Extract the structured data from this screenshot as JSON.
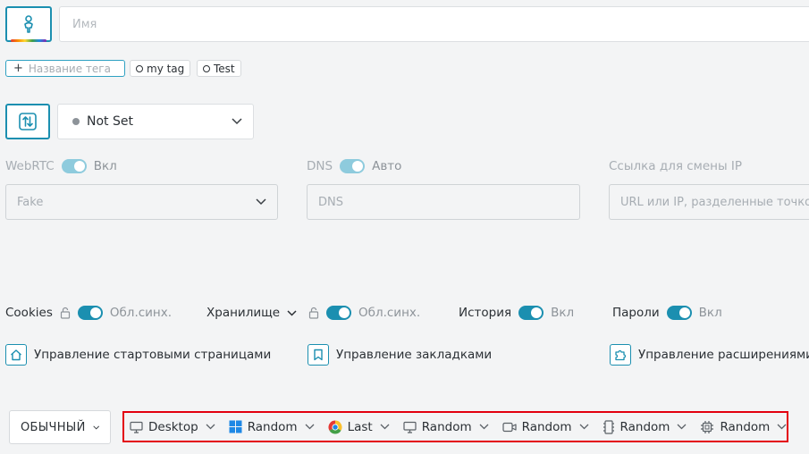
{
  "profile": {
    "name_placeholder": "Имя"
  },
  "tags": {
    "add_placeholder": "Название тега",
    "items": [
      {
        "label": "my tag"
      },
      {
        "label": "Test"
      }
    ]
  },
  "status": {
    "selected": "Not Set"
  },
  "webrtc": {
    "label": "WebRTC",
    "state": "Вкл",
    "value": "Fake"
  },
  "dns": {
    "label": "DNS",
    "state": "Авто",
    "placeholder": "DNS"
  },
  "ip_change": {
    "label": "Ссылка для смены IP",
    "placeholder": "URL или IP, разделенные точкой с запятой"
  },
  "sync": {
    "cookies_label": "Cookies",
    "cookies_state": "Обл.синх.",
    "storage_label": "Хранилище",
    "storage_state": "Обл.синх.",
    "history_label": "История",
    "history_state": "Вкл",
    "passwords_label": "Пароли",
    "passwords_state": "Вкл"
  },
  "links": {
    "start_pages": "Управление стартовыми страницами",
    "bookmarks": "Управление закладками",
    "extensions": "Управление расширениями"
  },
  "mode": {
    "label": "ОБЫЧНЫЙ"
  },
  "fingerprint": {
    "device": "Desktop",
    "os": "Random",
    "browser": "Last",
    "screen": "Random",
    "media": "Random",
    "memory": "Random",
    "cpu": "Random"
  },
  "colors": {
    "accent": "#1b8fb0",
    "highlight": "#e3000f",
    "background": "#f3f4f5"
  }
}
